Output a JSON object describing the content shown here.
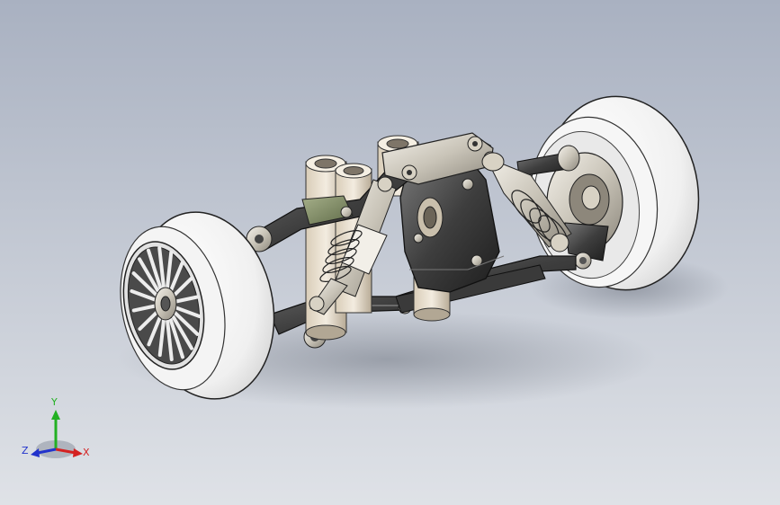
{
  "viewport": {
    "background_top": "#a9b1c1",
    "background_bottom": "#dfe2e7"
  },
  "model": {
    "parts": [
      "left-wheel",
      "right-wheel",
      "lower-control-arm",
      "upper-control-arm",
      "left-shock-absorber",
      "right-shock-absorber",
      "center-bulkhead",
      "drive-cups",
      "right-hub-carrier"
    ]
  },
  "triad": {
    "x_label": "X",
    "y_label": "Y",
    "z_label": "Z",
    "x_color": "#d42222",
    "y_color": "#22b022",
    "z_color": "#2233cc"
  }
}
